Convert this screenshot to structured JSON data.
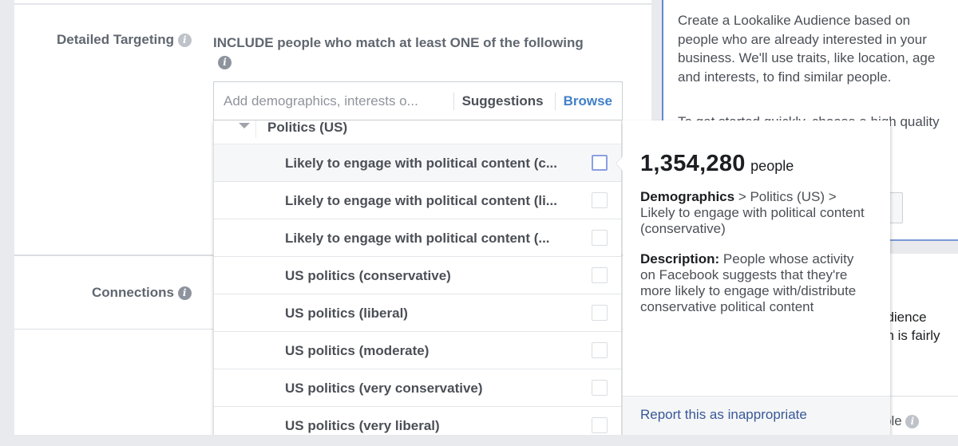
{
  "form": {
    "detailed_targeting_label": "Detailed Targeting",
    "connections_label": "Connections",
    "include_text": "INCLUDE people who match at least ONE of the following",
    "search": {
      "placeholder": "Add demographics, interests o...",
      "value": ""
    },
    "suggestions_label": "Suggestions",
    "browse_label": "Browse"
  },
  "dropdown": {
    "category": "Politics (US)",
    "options": [
      {
        "label": "Likely to engage with political content (c...",
        "checked": false,
        "hovered": true
      },
      {
        "label": "Likely to engage with political content (li...",
        "checked": false,
        "hovered": false
      },
      {
        "label": "Likely to engage with political content (...",
        "checked": false,
        "hovered": false
      },
      {
        "label": "US politics (conservative)",
        "checked": false,
        "hovered": false
      },
      {
        "label": "US politics (liberal)",
        "checked": false,
        "hovered": false
      },
      {
        "label": "US politics (moderate)",
        "checked": false,
        "hovered": false
      },
      {
        "label": "US politics (very conservative)",
        "checked": false,
        "hovered": false
      },
      {
        "label": "US politics (very liberal)",
        "checked": false,
        "hovered": false
      }
    ]
  },
  "tooltip": {
    "audience_size": "1,354,280",
    "audience_unit": "people",
    "path_root": "Demographics",
    "path_rest": " > Politics (US) > Likely to engage with political content (conservative)",
    "description_label": "Description:",
    "description_text": " People whose activity on Facebook suggests that they're more likely to engage with/distribute conservative political content",
    "report_link": "Report this as inappropriate"
  },
  "right_panel": {
    "paragraph1": "Create a Lookalike Audience based on people who are already interested in your business. We'll use traits, like location, age and interests, to find similar people.",
    "paragraph2_partial": "To get started quickly, choose a high quality source,",
    "lower_line1": "udience",
    "lower_line2": "on is fairly",
    "lower_people": "ple"
  },
  "colors": {
    "link_blue": "#4080c8",
    "report_link": "#385898",
    "panel_accent": "#5b8bd6"
  }
}
